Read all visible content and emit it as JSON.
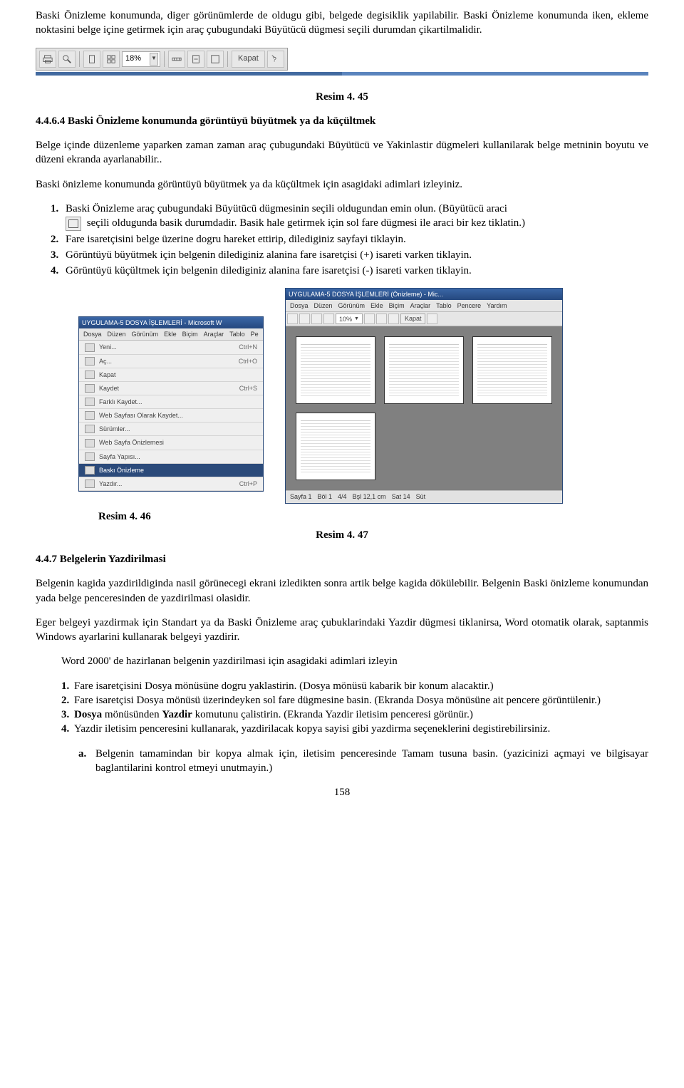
{
  "intro": {
    "p1": "Baski Önizleme konumunda, diger görünümlerde de oldugu gibi, belgede degisiklik yapilabilir. Baski Önizleme konumunda iken, ekleme noktasini belge içine getirmek için araç çubugundaki Büyütücü dügmesi seçili durumdan çikartilmalidir."
  },
  "toolbar45": {
    "zoom": "18%",
    "close_label": "Kapat"
  },
  "caption45": "Resim 4. 45",
  "sec464": {
    "heading": "4.4.6.4 Baski Önizleme konumunda görüntüyü büyütmek  ya da küçültmek",
    "p1": "Belge içinde düzenleme yaparken zaman zaman araç çubugundaki Büyütücü ve Yakinlastir dügmeleri kullanilarak belge metninin boyutu ve düzeni ekranda ayarlanabilir..",
    "p2": "Baski önizleme konumunda görüntüyü büyütmek ya da küçültmek için asagidaki adimlari izleyiniz.",
    "steps": [
      "Baski Önizleme araç çubugundaki Büyütücü dügmesinin seçili oldugundan emin olun. (Büyütücü araci",
      "seçili oldugunda basik durumdadir. Basik hale getirmek için sol fare dügmesi ile araci bir kez tiklatin.)",
      "Fare isaretçisini belge üzerine dogru hareket ettirip, dilediginiz sayfayi tiklayin.",
      "Görüntüyü büyütmek için belgenin dilediginiz alanina fare isaretçisi (+) isareti varken tiklayin.",
      "Görüntüyü küçültmek için belgenin dilediginiz alanina fare isaretçisi (-) isareti varken tiklayin."
    ]
  },
  "fig46": {
    "title": "UYGULAMA-5 DOSYA İŞLEMLERİ - Microsoft W",
    "menus": [
      "Dosya",
      "Düzen",
      "Görünüm",
      "Ekle",
      "Biçim",
      "Araçlar",
      "Tablo",
      "Pe"
    ],
    "items": [
      {
        "label": "Yeni...",
        "short": "Ctrl+N"
      },
      {
        "label": "Aç...",
        "short": "Ctrl+O"
      },
      {
        "label": "Kapat",
        "short": ""
      },
      {
        "label": "Kaydet",
        "short": "Ctrl+S"
      },
      {
        "label": "Farklı Kaydet...",
        "short": ""
      },
      {
        "label": "Web Sayfası Olarak Kaydet...",
        "short": ""
      },
      {
        "label": "Sürümler...",
        "short": ""
      },
      {
        "label": "Web Sayfa Önizlemesi",
        "short": ""
      },
      {
        "label": "Sayfa Yapısı...",
        "short": ""
      },
      {
        "label": "Baskı Önizleme",
        "short": "",
        "hi": true
      },
      {
        "label": "Yazdır...",
        "short": "Ctrl+P"
      }
    ],
    "caption": "Resim 4. 46"
  },
  "fig47": {
    "title": "UYGULAMA-5 DOSYA İŞLEMLERİ (Önizleme) - Mic...",
    "menus": [
      "Dosya",
      "Düzen",
      "Görünüm",
      "Ekle",
      "Biçim",
      "Araçlar",
      "Tablo",
      "Pencere",
      "Yardım"
    ],
    "zoom": "10%",
    "close": "Kapat",
    "status": [
      "Sayfa 1",
      "Böl 1",
      "4/4",
      "Bşl 12,1 cm",
      "Sat 14",
      "Süt"
    ],
    "caption": "Resim 4. 47"
  },
  "sec447": {
    "heading": "4.4.7 Belgelerin  Yazdirilmasi",
    "p1": "Belgenin kagida yazdirildiginda nasil görünecegi ekrani izledikten sonra artik belge kagida dökülebilir. Belgenin Baski önizleme konumundan yada belge penceresinden de yazdirilmasi olasidir.",
    "p2": "Eger belgeyi yazdirmak için Standart ya da Baski Önizleme araç çubuklarindaki Yazdir dügmesi tiklanirsa, Word otomatik olarak, saptanmis Windows ayarlarini kullanarak belgeyi yazdirir.",
    "p3": "Word 2000' de hazirlanan belgenin yazdirilmasi için asagidaki adimlari izleyin",
    "steps": [
      {
        "n": "1.",
        "t": "Fare isaretçisini Dosya mönüsüne dogru yaklastirin. (Dosya mönüsü kabarik bir konum alacaktir.)"
      },
      {
        "n": "2.",
        "t": "Fare isaretçisi Dosya mönüsü üzerindeyken sol fare dügmesine basin. (Ekranda Dosya mönüsüne ait pencere görüntülenir.)"
      },
      {
        "n": "3.",
        "t": "Dosya mönüsünden Yazdir komutunu çalistirin. (Ekranda Yazdir iletisim penceresi görünür.)",
        "b": [
          "Dosya",
          "Yazdir"
        ]
      },
      {
        "n": "4.",
        "t": "Yazdir iletisim penceresini kullanarak, yazdirilacak kopya sayisi gibi yazdirma seçeneklerini degistirebilirsiniz."
      }
    ],
    "sub": {
      "n": "a.",
      "t": "Belgenin tamamindan bir kopya almak için, iletisim penceresinde Tamam tusuna basin. (yazicinizi açmayi  ve bilgisayar baglantilarini kontrol etmeyi unutmayin.)"
    }
  },
  "pagenum": "158"
}
